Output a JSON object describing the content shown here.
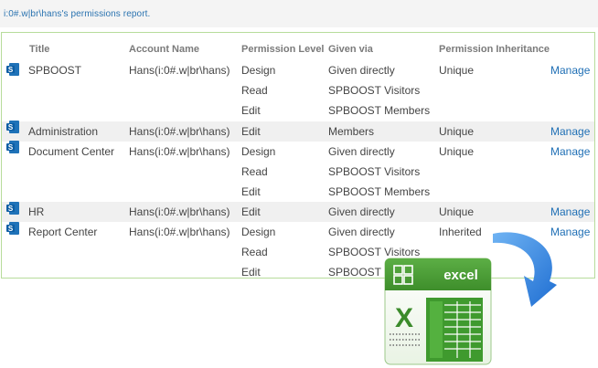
{
  "report": {
    "heading": "i:0#.w|br\\hans's permissions report."
  },
  "columns": {
    "title": "Title",
    "account": "Account Name",
    "level": "Permission Level",
    "given_via": "Given via",
    "inheritance": "Permission Inheritance"
  },
  "rows": [
    {
      "icon": "sharepoint-icon",
      "title": "SPBOOST",
      "account": "Hans(i:0#.w|br\\hans)",
      "level": "Design",
      "given_via": "Given directly",
      "inheritance": "Unique",
      "action": "Manage"
    },
    {
      "level": "Read",
      "given_via": "SPBOOST Visitors"
    },
    {
      "level": "Edit",
      "given_via": "SPBOOST Members"
    },
    {
      "icon": "sharepoint-icon",
      "title": "Administration",
      "account": "Hans(i:0#.w|br\\hans)",
      "level": "Edit",
      "given_via": "Members",
      "inheritance": "Unique",
      "action": "Manage"
    },
    {
      "icon": "sharepoint-icon",
      "title": "Document Center",
      "account": "Hans(i:0#.w|br\\hans)",
      "level": "Design",
      "given_via": "Given directly",
      "inheritance": "Unique",
      "action": "Manage"
    },
    {
      "level": "Read",
      "given_via": "SPBOOST Visitors"
    },
    {
      "level": "Edit",
      "given_via": "SPBOOST Members"
    },
    {
      "icon": "sharepoint-icon",
      "title": "HR",
      "account": "Hans(i:0#.w|br\\hans)",
      "level": "Edit",
      "given_via": "Given directly",
      "inheritance": "Unique",
      "action": "Manage"
    },
    {
      "icon": "sharepoint-icon",
      "title": "Report Center",
      "account": "Hans(i:0#.w|br\\hans)",
      "level": "Design",
      "given_via": "Given directly",
      "inheritance": "Inherited",
      "action": "Manage"
    },
    {
      "level": "Read",
      "given_via": "SPBOOST Visitors"
    },
    {
      "level": "Edit",
      "given_via": "SPBOOST M"
    }
  ],
  "excel": {
    "label": "excel",
    "letter": "X",
    "brand_color": "#4a9d3a",
    "arrow_color": "#3f8de0"
  }
}
